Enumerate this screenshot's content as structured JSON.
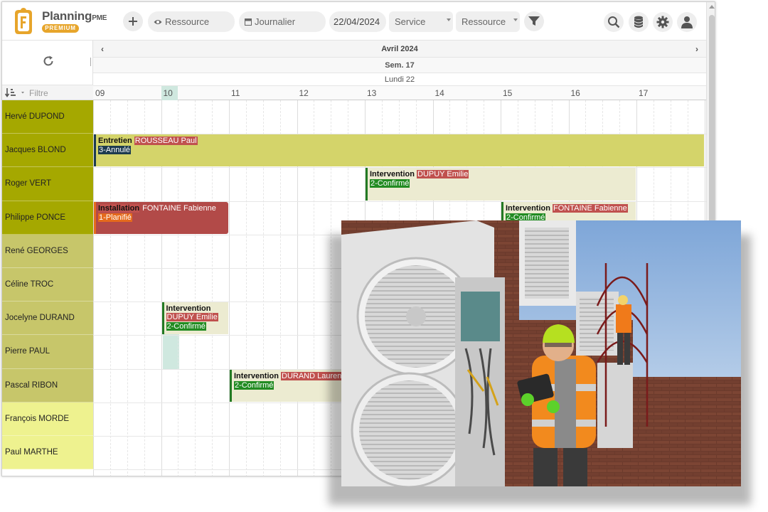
{
  "app": {
    "brand": "Planning",
    "brand_sub": "PME",
    "badge": "PREMIUM"
  },
  "toolbar": {
    "resource_search": "Ressource",
    "view_mode": "Journalier",
    "date": "22/04/2024",
    "service_select": "Service",
    "resource_select": "Ressource"
  },
  "left": {
    "filter_placeholder": "Filtre"
  },
  "calendar": {
    "month": "Avril 2024",
    "week": "Sem. 17",
    "day": "Lundi 22",
    "hours": [
      "09",
      "10",
      "11",
      "12",
      "13",
      "14",
      "15",
      "16",
      "17"
    ],
    "highlight_hour": "10"
  },
  "resources": [
    {
      "name": "Hervé DUPOND",
      "color": "#a5a800"
    },
    {
      "name": "Jacques BLOND",
      "color": "#a5a800"
    },
    {
      "name": "Roger VERT",
      "color": "#a5a800"
    },
    {
      "name": "Philippe PONCE",
      "color": "#a5a800"
    },
    {
      "name": "René GEORGES",
      "color": "#c7c66a"
    },
    {
      "name": "Céline TROC",
      "color": "#c7c66a"
    },
    {
      "name": "Jocelyne DURAND",
      "color": "#c7c66a"
    },
    {
      "name": "Pierre PAUL",
      "color": "#c7c66a"
    },
    {
      "name": "Pascal RIBON",
      "color": "#c7c66a"
    },
    {
      "name": "François MORDE",
      "color": "#eef28f"
    },
    {
      "name": "Paul MARTHE",
      "color": "#eef28f"
    }
  ],
  "events": [
    {
      "row": 1,
      "start": 9.0,
      "end": 18.0,
      "type": "Entretien",
      "client": "ROUSSEAU Paul",
      "status": "3-Annulé",
      "status_style": "dark",
      "bg": "#d4d46a",
      "border": "#1d3b4f"
    },
    {
      "row": 2,
      "start": 13.0,
      "end": 17.0,
      "type": "Intervention",
      "client": "DUPUY Emilie",
      "status": "2-Confirmé",
      "status_style": "green",
      "bg": "#ecebd1",
      "border": "#237a23"
    },
    {
      "row": 3,
      "start": 9.0,
      "end": 11.0,
      "type": "Installation",
      "client": "FONTAINE Fabienne",
      "status": "1-Planifié",
      "status_style": "orange",
      "bg": "#b24a48",
      "border": "#e56a1c",
      "light": true
    },
    {
      "row": 3,
      "start": 15.0,
      "end": 17.0,
      "type": "Intervention",
      "client": "FONTAINE Fabienne",
      "status": "2-Confirmé",
      "status_style": "green",
      "bg": "#ecebd1",
      "border": "#237a23"
    },
    {
      "row": 6,
      "start": 10.0,
      "end": 11.0,
      "type": "Intervention",
      "client": "DUPUY Emilie",
      "status": "2-Confirmé",
      "status_style": "green",
      "bg": "#ecebd1",
      "border": "#237a23",
      "wrap": true
    },
    {
      "row": 8,
      "start": 11.0,
      "end": 13.0,
      "type": "Intervention",
      "client": "DURAND Laurent",
      "status": "2-Confirmé",
      "status_style": "green",
      "bg": "#ecebd1",
      "border": "#237a23"
    }
  ],
  "colors": {
    "accent": "#e7a52b",
    "highlight": "#cfe8df"
  },
  "photo": {
    "subject": "technician-inspecting-heat-pump-units"
  }
}
